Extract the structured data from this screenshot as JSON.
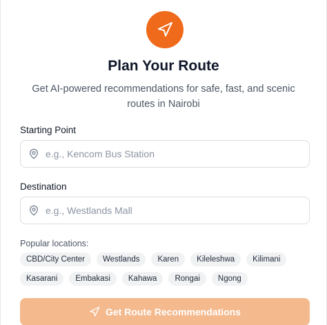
{
  "header": {
    "logo_icon": "navigation-arrow-icon",
    "title": "Plan Your Route",
    "subtitle": "Get AI-powered recommendations for safe, fast, and scenic routes in Nairobi"
  },
  "form": {
    "start": {
      "label": "Starting Point",
      "placeholder": "e.g., Kencom Bus Station",
      "value": "",
      "icon": "map-pin-icon"
    },
    "destination": {
      "label": "Destination",
      "placeholder": "e.g., Westlands Mall",
      "value": "",
      "icon": "map-pin-icon"
    },
    "popular_label": "Popular locations:",
    "popular_locations": [
      "CBD/City Center",
      "Westlands",
      "Karen",
      "Kileleshwa",
      "Kilimani",
      "Kasarani",
      "Embakasi",
      "Kahawa",
      "Rongai",
      "Ngong"
    ],
    "submit": {
      "label": "Get Route Recommendations",
      "icon": "navigation-arrow-icon"
    }
  },
  "colors": {
    "accent": "#ef6a1a",
    "button_disabled": "#f4b98d",
    "chip_bg": "#f1f2f4"
  }
}
